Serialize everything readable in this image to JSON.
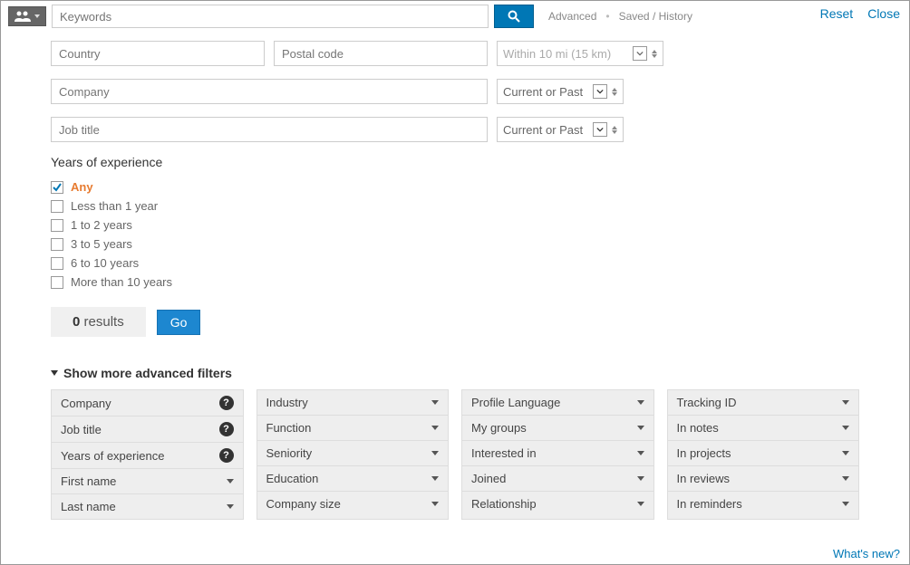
{
  "search": {
    "keywords_placeholder": "Keywords",
    "advanced": "Advanced",
    "saved_history": "Saved / History"
  },
  "actions": {
    "reset": "Reset",
    "close": "Close"
  },
  "fields": {
    "country_placeholder": "Country",
    "postal_placeholder": "Postal code",
    "distance_label": "Within 10 mi (15 km)",
    "company_placeholder": "Company",
    "company_scope": "Current or Past",
    "title_placeholder": "Job title",
    "title_scope": "Current or Past"
  },
  "experience": {
    "label": "Years of experience",
    "options": [
      "Any",
      "Less than 1 year",
      "1 to 2 years",
      "3 to 5 years",
      "6 to 10 years",
      "More than 10 years"
    ]
  },
  "results": {
    "count": "0",
    "word": "results",
    "go": "Go"
  },
  "advanced_filters": {
    "heading": "Show more advanced filters",
    "col1": [
      "Company",
      "Job title",
      "Years of experience",
      "First name",
      "Last name"
    ],
    "col1_help": [
      true,
      true,
      true,
      false,
      false
    ],
    "col2": [
      "Industry",
      "Function",
      "Seniority",
      "Education",
      "Company size"
    ],
    "col3": [
      "Profile Language",
      "My groups",
      "Interested in",
      "Joined",
      "Relationship"
    ],
    "col4": [
      "Tracking ID",
      "In notes",
      "In projects",
      "In reviews",
      "In reminders"
    ]
  },
  "footer": {
    "whatsnew": "What's new?"
  }
}
